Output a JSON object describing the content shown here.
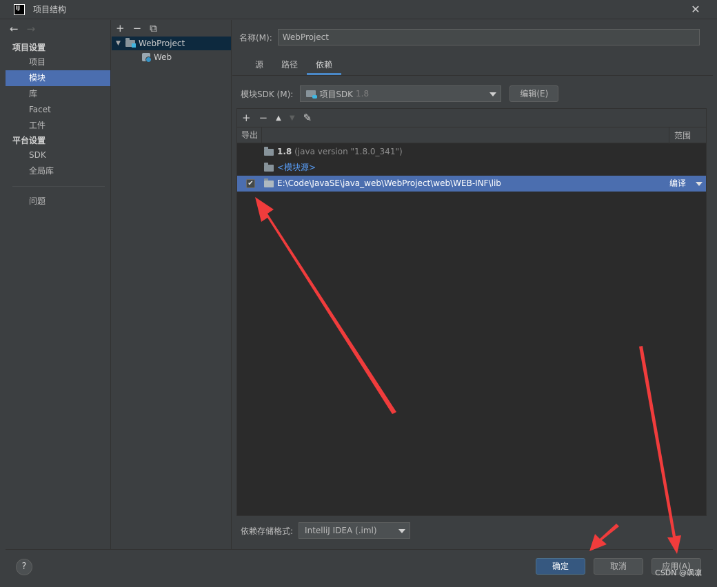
{
  "window": {
    "title": "项目结构",
    "app_logo": "IJ",
    "close_symbol": "✕"
  },
  "nav": {
    "back_symbol": "←",
    "forward_symbol": "→",
    "section_project": "项目设置",
    "items_project": [
      "项目",
      "模块",
      "库",
      "Facet",
      "工件"
    ],
    "selected": "模块",
    "section_platform": "平台设置",
    "items_platform": [
      "SDK",
      "全局库"
    ],
    "problems": "问题"
  },
  "tree": {
    "add": "+",
    "remove": "−",
    "copy": "⧉",
    "root": "WebProject",
    "child": "Web"
  },
  "module": {
    "name_label": "名称(M):",
    "name_value": "WebProject",
    "tabs": [
      "源",
      "路径",
      "依赖"
    ],
    "active_tab": "依赖",
    "sdk_label": "模块SDK (M):",
    "sdk_value": "项目SDK",
    "sdk_version": "1.8",
    "edit_button": "编辑(E)"
  },
  "deps": {
    "toolbar": {
      "add": "+",
      "remove": "−",
      "up": "▲",
      "down": "▼",
      "edit": "✎"
    },
    "col_export": "导出",
    "col_scope": "范围",
    "rows": [
      {
        "name": "1.8",
        "detail": "(java version \"1.8.0_341\")"
      },
      {
        "name": "<模块源>"
      },
      {
        "name": "E:\\Code\\JavaSE\\java_web\\WebProject\\web\\WEB-INF\\lib",
        "scope": "编译",
        "checked_symbol": "✔"
      }
    ],
    "storage_label": "依赖存储格式:",
    "storage_value": "IntelliJ IDEA (.iml)"
  },
  "footer": {
    "help": "?",
    "ok": "确定",
    "cancel": "取消",
    "apply": "应用(A)",
    "watermark": "CSDN @飒凛"
  },
  "colors": {
    "accent": "#4b6eaf",
    "ok_button": "#365880",
    "annotation_arrow": "#f03c3c"
  }
}
